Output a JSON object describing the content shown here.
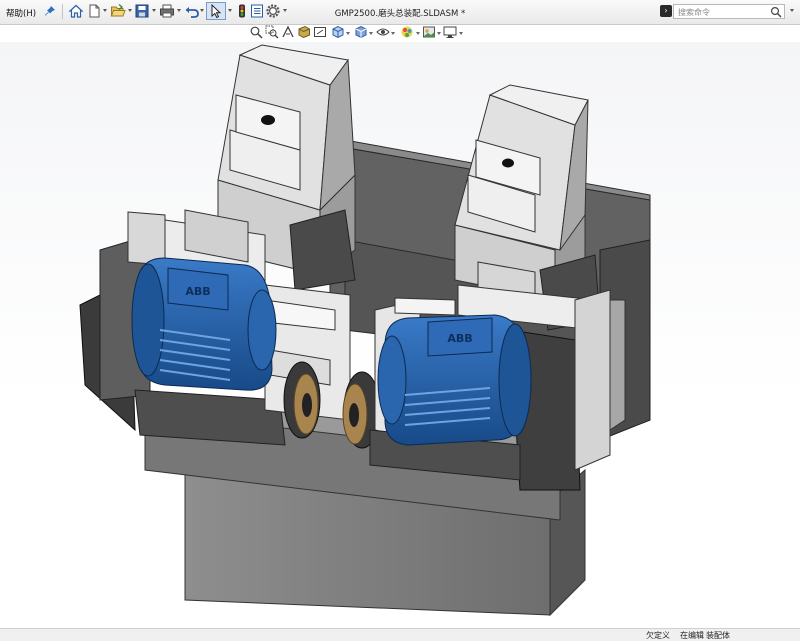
{
  "menubar": {
    "help_label": "帮助(H)"
  },
  "document": {
    "title": "GMP2500.磨头总装配.SLDASM *"
  },
  "search": {
    "placeholder": "搜索命令"
  },
  "model": {
    "motor_brand": "ABB"
  },
  "statusbar": {
    "definition": "欠定义",
    "editing": "在编辑",
    "target": "装配体"
  },
  "colors": {
    "motor_blue": "#1f5aa0",
    "frame_gray": "#8a8a8a",
    "dark_gray": "#3e3e3e",
    "light_gray": "#dcdcdc",
    "viewport_top": "#f4f5f7",
    "wheel_bronze": "#a8854f"
  },
  "icons": [
    "pin-icon",
    "home-icon",
    "new-file-icon",
    "open-folder-icon",
    "save-icon",
    "print-icon",
    "undo-icon",
    "select-arrow-icon",
    "traffic-light-icon",
    "options-list-icon",
    "gear-icon",
    "search-icon",
    "zoom-fit-icon",
    "zoom-area-icon",
    "previous-view-icon",
    "section-view-icon",
    "view-cube-icon",
    "display-style-icon",
    "hide-show-icon",
    "appearance-icon",
    "scene-icon",
    "monitor-icon"
  ]
}
